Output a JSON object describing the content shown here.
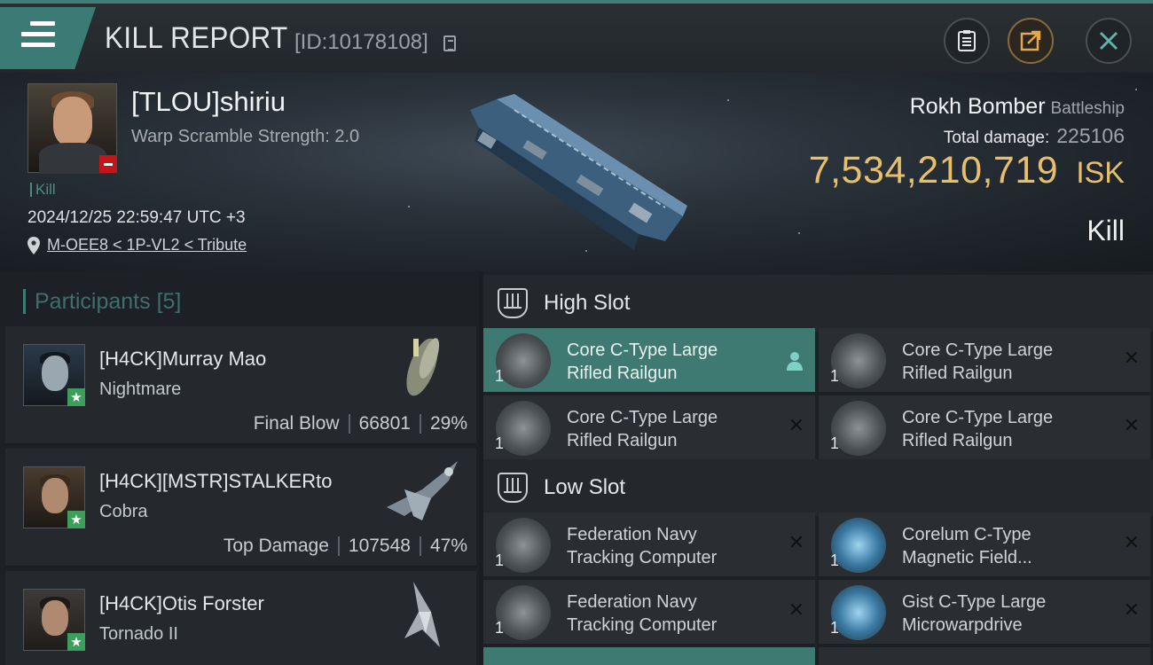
{
  "header": {
    "title": "KILL REPORT",
    "report_id": "[ID:10178108]"
  },
  "victim": {
    "name": "[TLOU]shiriu",
    "warp_scramble": "Warp Scramble Strength: 2.0",
    "kill_tag": "Kill",
    "datetime": "2024/12/25 22:59:47 UTC +3",
    "location": "M-OEE8 < 1P-VL2 < Tribute",
    "ship_name": "Rokh Bomber",
    "ship_class": "Battleship",
    "total_damage_label": "Total damage:",
    "total_damage": "225106",
    "isk_value": "7,534,210,719",
    "isk_unit": "ISK",
    "result": "Kill"
  },
  "participants": {
    "title": "Participants",
    "count": "[5]",
    "items": [
      {
        "name": "[H4CK]Murray Mao",
        "ship": "Nightmare",
        "label": "Final Blow",
        "damage": "66801",
        "percent": "29%"
      },
      {
        "name": "[H4CK][MSTR]STALKERto",
        "ship": "Cobra",
        "label": "Top Damage",
        "damage": "107548",
        "percent": "47%"
      },
      {
        "name": "[H4CK]Otis Forster",
        "ship": "Tornado II"
      }
    ]
  },
  "slots": {
    "high": {
      "label": "High Slot",
      "items": [
        {
          "name1": "Core C-Type Large",
          "name2": "Rifled Railgun",
          "qty": "1"
        },
        {
          "name1": "Core C-Type Large",
          "name2": "Rifled Railgun",
          "qty": "1"
        },
        {
          "name1": "Core C-Type Large",
          "name2": "Rifled Railgun",
          "qty": "1"
        },
        {
          "name1": "Core C-Type Large",
          "name2": "Rifled Railgun",
          "qty": "1"
        }
      ]
    },
    "low": {
      "label": "Low Slot",
      "items": [
        {
          "name1": "Federation Navy",
          "name2": "Tracking Computer",
          "qty": "1"
        },
        {
          "name1": "Corelum C-Type",
          "name2": "Magnetic Field...",
          "qty": "1"
        },
        {
          "name1": "Federation Navy",
          "name2": "Tracking Computer",
          "qty": "1"
        },
        {
          "name1": "Gist C-Type Large",
          "name2": "Microwarpdrive",
          "qty": "1"
        }
      ]
    }
  },
  "colors": {
    "accent": "#3f7e76",
    "isk": "#e7bf6b",
    "selected_slot": "#3e7a72"
  }
}
